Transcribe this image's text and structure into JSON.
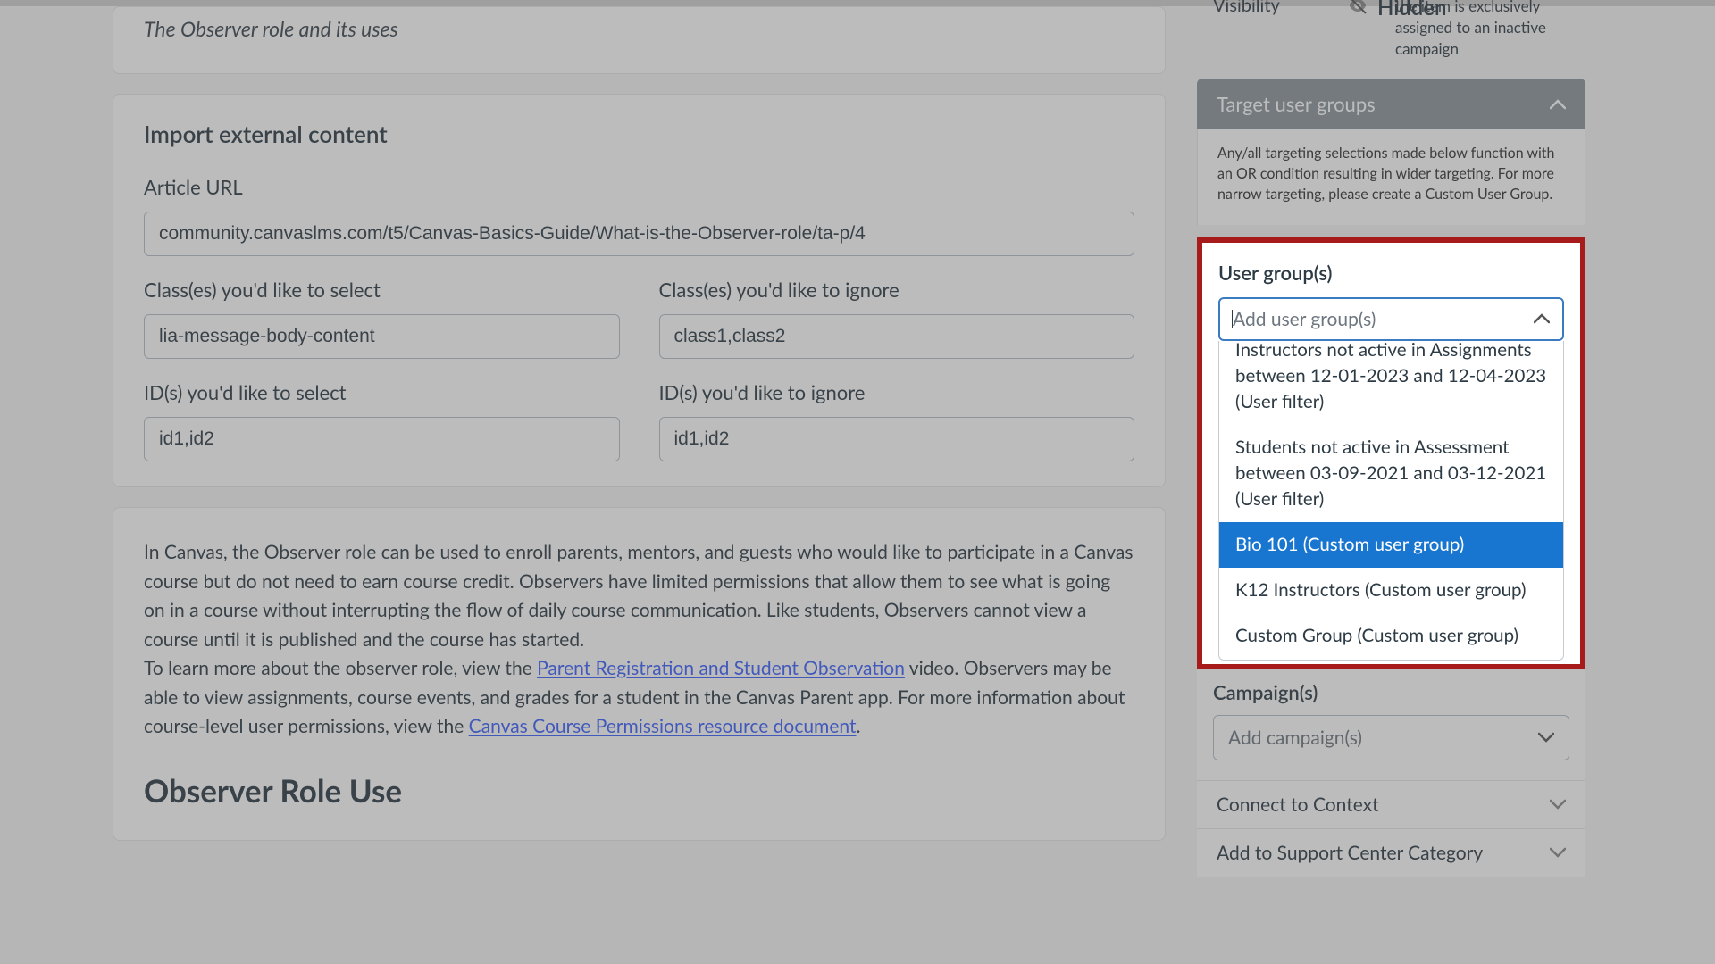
{
  "topCard": {
    "subtitle": "The Observer role and its uses"
  },
  "importSection": {
    "heading": "Import external content",
    "urlLabel": "Article URL",
    "urlValue": "community.canvaslms.com/t5/Canvas-Basics-Guide/What-is-the-Observer-role/ta-p/4",
    "classSelectLabel": "Class(es) you'd like to select",
    "classSelectValue": "lia-message-body-content",
    "classIgnoreLabel": "Class(es) you'd like to ignore",
    "classIgnoreValue": "class1,class2",
    "idSelectLabel": "ID(s) you'd like to select",
    "idSelectValue": "id1,id2",
    "idIgnoreLabel": "ID(s) you'd like to ignore",
    "idIgnoreValue": "id1,id2"
  },
  "article": {
    "para1_a": "In Canvas, the Observer role can be used to enroll parents, mentors, and guests who would like to participate in a Canvas course but do not need to earn course credit. Observers have limited permissions that allow them to see what is going on in a course without interrupting the flow of daily course communication. Like students, Observers cannot view a course until it is published and the course has started.",
    "para2_a": "To learn more about the observer role, view the ",
    "link1": "Parent Registration and Student Observation",
    "para2_b": " video. Observers may be able to view assignments, course events, and grades for a student in the Canvas Parent app. For more information about course-level user permissions, view the ",
    "link2": "Canvas Course Permissions resource document",
    "para2_c": ".",
    "h2": "Observer Role Use"
  },
  "sidebar": {
    "visibilityLabel": "Visibility",
    "visibilityValue": "Hidden",
    "visibilityHint": "the item is exclusively assigned to an inactive campaign",
    "targetHeading": "Target user groups",
    "targetHelp": "Any/all targeting selections made below function with an OR condition resulting in wider targeting. For more narrow targeting, please create a Custom User Group.",
    "userGroupLabel": "User group(s)",
    "userGroupPlaceholder": "Add user group(s)",
    "options": [
      "Instructors not active in Assignments between 12-01-2023 and 12-04-2023 (User filter)",
      "Students not active in Assessment between 03-09-2021 and 03-12-2021 (User filter)",
      "Bio 101 (Custom user group)",
      "K12 Instructors (Custom user group)",
      "Custom Group (Custom user group)"
    ],
    "highlightedIndex": 2,
    "campaignLabel": "Campaign(s)",
    "campaignPlaceholder": "Add campaign(s)",
    "connectHeading": "Connect to Context",
    "supportHeading": "Add to Support Center Category"
  },
  "colors": {
    "highlightBorder": "#a81b1b",
    "optionHighlight": "#1876d1"
  }
}
